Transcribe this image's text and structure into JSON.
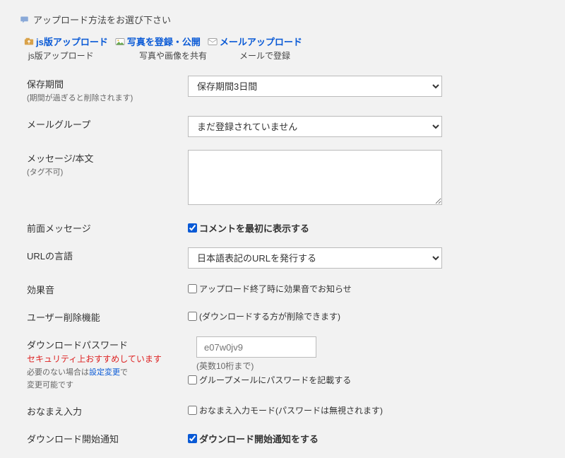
{
  "section_title": "アップロード方法をお選び下さい",
  "tabs": [
    {
      "label": "js版アップロード",
      "sub": "js版アップロード"
    },
    {
      "label": "写真を登録・公開",
      "sub": "写真や画像を共有"
    },
    {
      "label": "メールアップロード",
      "sub": "メールで登録"
    }
  ],
  "retention": {
    "label": "保存期間",
    "hint": "(期間が過ぎると削除されます)",
    "value": "保存期間3日間"
  },
  "mail_group": {
    "label": "メールグループ",
    "value": "まだ登録されていません"
  },
  "message": {
    "label": "メッセージ/本文",
    "hint": "(タグ不可)",
    "value": ""
  },
  "front_message": {
    "label": "前面メッセージ",
    "checkbox": "コメントを最初に表示する",
    "checked": true
  },
  "url_lang": {
    "label": "URLの言語",
    "value": "日本語表記のURLを発行する"
  },
  "sound": {
    "label": "効果音",
    "checkbox": "アップロード終了時に効果音でお知らせ",
    "checked": false
  },
  "user_delete": {
    "label": "ユーザー削除機能",
    "checkbox": "(ダウンロードする方が削除できます)",
    "checked": false
  },
  "dl_password": {
    "label": "ダウンロードパスワード",
    "warn": "セキュリティ上おすすめしています",
    "help_pre": "必要のない場合は",
    "help_link": "設定変更",
    "help_post": "で",
    "help_line2": "変更可能です",
    "placeholder": "e07w0jv9",
    "note": "(英数10桁まで)",
    "checkbox": "グループメールにパスワードを記載する",
    "checked": false
  },
  "name_input": {
    "label": "おなまえ入力",
    "checkbox": "おなまえ入力モード(パスワードは無視されます)",
    "checked": false
  },
  "dl_notify": {
    "label": "ダウンロード開始通知",
    "checkbox": "ダウンロード開始通知をする",
    "checked": true
  }
}
